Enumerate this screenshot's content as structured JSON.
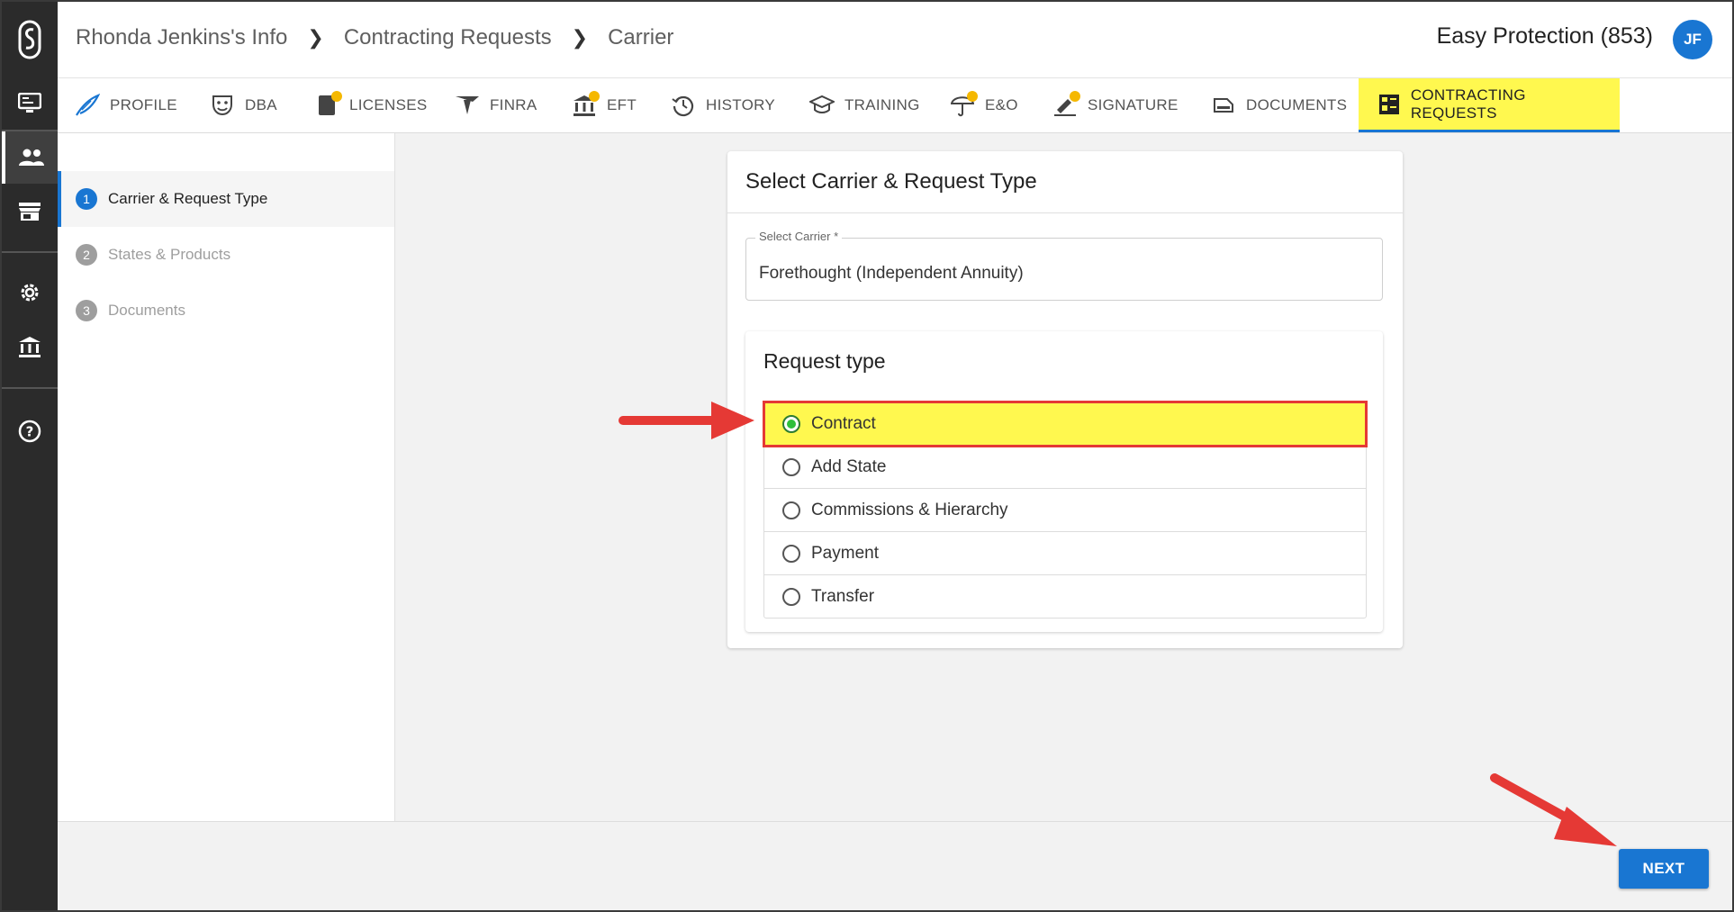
{
  "breadcrumb": [
    "Rhonda Jenkins's Info",
    "Contracting Requests",
    "Carrier"
  ],
  "agency": "Easy Protection (853)",
  "user_initials": "JF",
  "tabs": [
    {
      "label": "PROFILE",
      "icon": "feather-icon"
    },
    {
      "label": "DBA",
      "icon": "mask-icon"
    },
    {
      "label": "LICENSES",
      "icon": "license-icon",
      "badge": true
    },
    {
      "label": "FINRA",
      "icon": "finra-icon"
    },
    {
      "label": "EFT",
      "icon": "bank-icon",
      "badge": true
    },
    {
      "label": "HISTORY",
      "icon": "history-icon"
    },
    {
      "label": "TRAINING",
      "icon": "graduation-cap-icon"
    },
    {
      "label": "E&O",
      "icon": "umbrella-icon",
      "badge": true
    },
    {
      "label": "SIGNATURE",
      "icon": "signature-icon",
      "badge": true
    },
    {
      "label": "DOCUMENTS",
      "icon": "documents-icon"
    },
    {
      "label": "CONTRACTING REQUESTS",
      "icon": "contracting-requests-icon",
      "active": true
    }
  ],
  "steps": [
    {
      "num": "1",
      "label": "Carrier & Request Type",
      "active": true
    },
    {
      "num": "2",
      "label": "States & Products"
    },
    {
      "num": "3",
      "label": "Documents"
    }
  ],
  "card": {
    "title": "Select Carrier & Request Type",
    "carrier_label": "Select Carrier *",
    "carrier_value": "Forethought (Independent Annuity)",
    "request_type_title": "Request type",
    "options": [
      "Contract",
      "Add State",
      "Commissions & Hierarchy",
      "Payment",
      "Transfer"
    ],
    "selected": "Contract"
  },
  "next_label": "NEXT",
  "colors": {
    "accent": "#1976d2",
    "highlight": "#fff84f",
    "annotation": "#e53935",
    "badge": "#f5b800",
    "rail": "#2b2b2b"
  }
}
